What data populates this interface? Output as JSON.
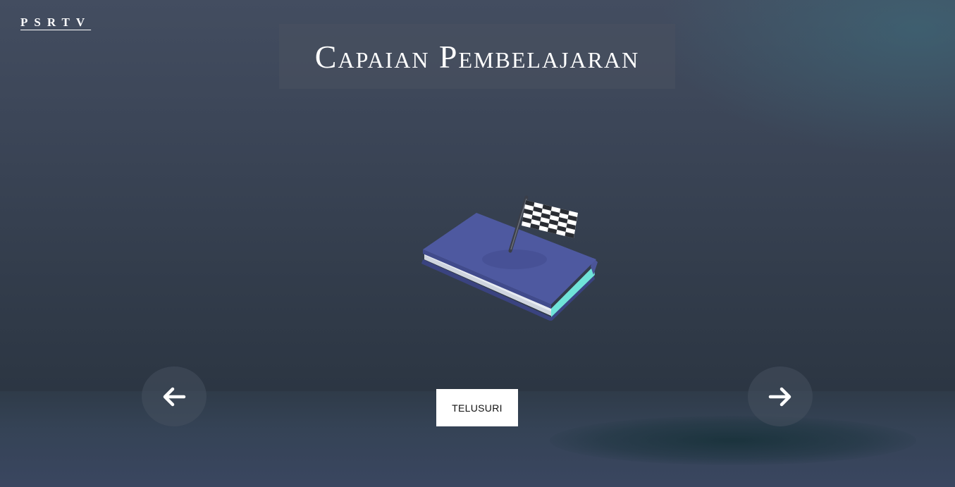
{
  "brand": {
    "logo_text": "PSRTV"
  },
  "slide": {
    "title": "Capaian Pembelajaran",
    "illustration_icon": "book-with-checkered-flag-icon"
  },
  "navigation": {
    "prev_icon": "arrow-left-icon",
    "next_icon": "arrow-right-icon"
  },
  "actions": {
    "explore_label": "TELUSURI"
  },
  "colors": {
    "background_top": "#434d60",
    "background_bottom": "#2a3440",
    "book_cover": "#4e59a0",
    "book_spine_edge": "#6fe3d9",
    "button_bg": "#ffffff"
  }
}
